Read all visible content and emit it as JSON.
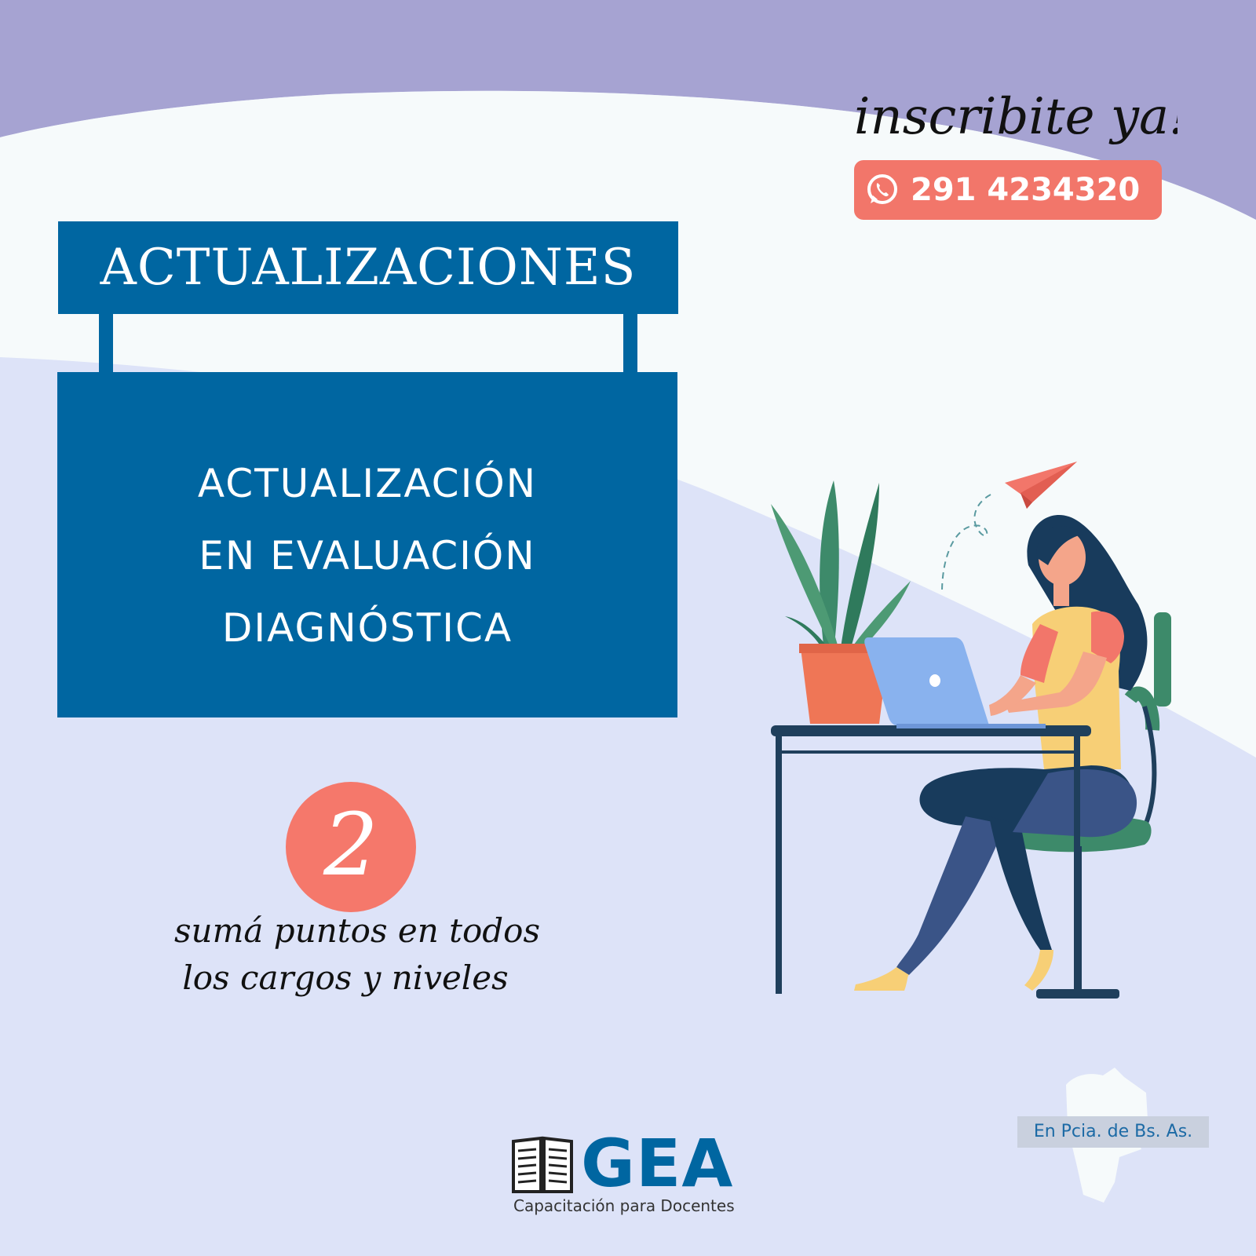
{
  "colors": {
    "background": "#dde3f8",
    "lavender_band": "#a6a3d2",
    "white_band": "#f6fafb",
    "brand_blue": "#0066a1",
    "coral": "#f2766a"
  },
  "header": {
    "cta_script": "inscribite ya!",
    "phone_icon": "whatsapp-icon",
    "phone_number": "291 4234320"
  },
  "banner": {
    "title": "ACTUALIZACIONES"
  },
  "course": {
    "line1": "ACTUALIZACIÓN",
    "line2": "EN EVALUACIÓN",
    "line3": "DIAGNÓSTICA"
  },
  "points": {
    "number": "2",
    "tagline_line1": "sumá puntos en todos",
    "tagline_line2": "los cargos y niveles"
  },
  "logo": {
    "brand": "GEA",
    "subtitle": "Capacitación para Docentes",
    "icon": "open-book-icon"
  },
  "region": {
    "label": "En Pcia. de Bs. As.",
    "icon": "province-map-icon"
  },
  "illustration": {
    "icon": "woman-at-laptop-illustration"
  }
}
